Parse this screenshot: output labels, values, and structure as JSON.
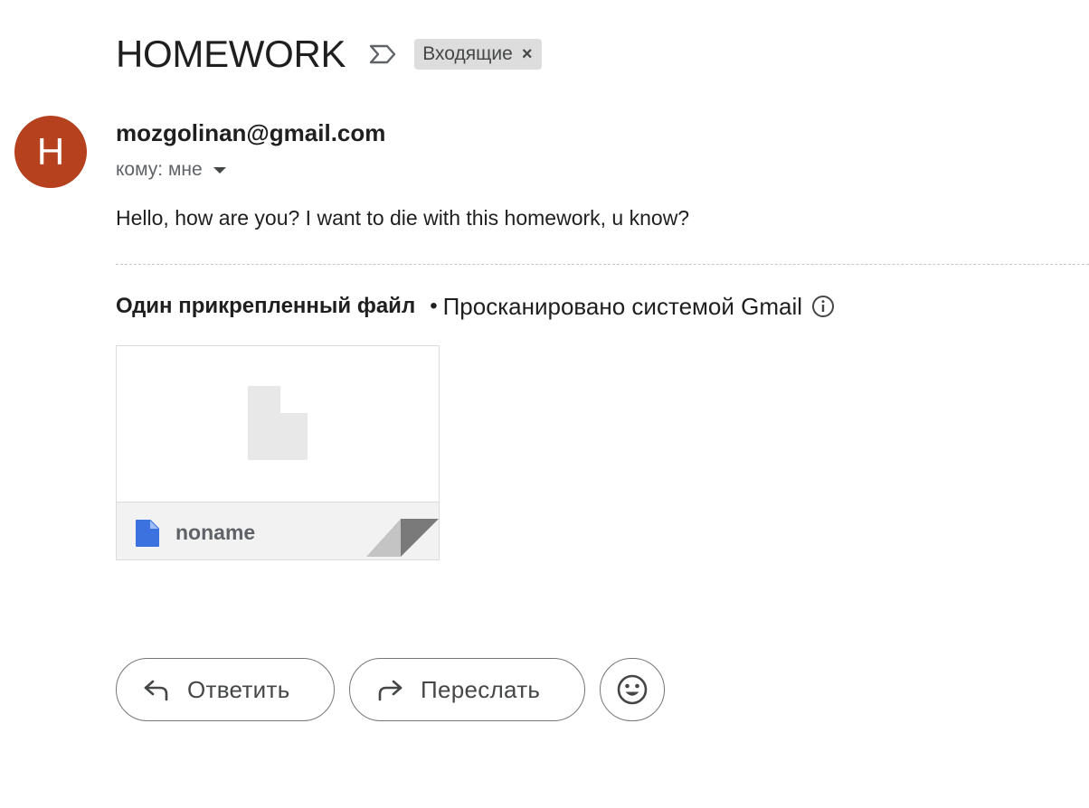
{
  "email": {
    "subject": "HOMEWORK",
    "label": {
      "text": "Входящие",
      "close": "×"
    },
    "sender": {
      "avatar_letter": "H",
      "avatar_color": "#b5411f",
      "email": "mozgolinan@gmail.com"
    },
    "recipient_text": "кому: мне",
    "body": "Hello, how are you? I want to die with this homework, u know?"
  },
  "attachments": {
    "count_label": "Один прикрепленный файл",
    "separator": "•",
    "scan_text": "Просканировано системой Gmail",
    "files": [
      {
        "name": "noname",
        "icon": "document-icon",
        "icon_color": "#3b72e0"
      }
    ]
  },
  "actions": {
    "reply_label": "Ответить",
    "forward_label": "Переслать",
    "emoji_icon": "smiley-icon"
  },
  "icons": {
    "importance": "importance-marker-icon",
    "info": "info-icon",
    "reply": "reply-arrow-icon",
    "forward": "forward-arrow-icon",
    "caret": "caret-down-icon"
  }
}
